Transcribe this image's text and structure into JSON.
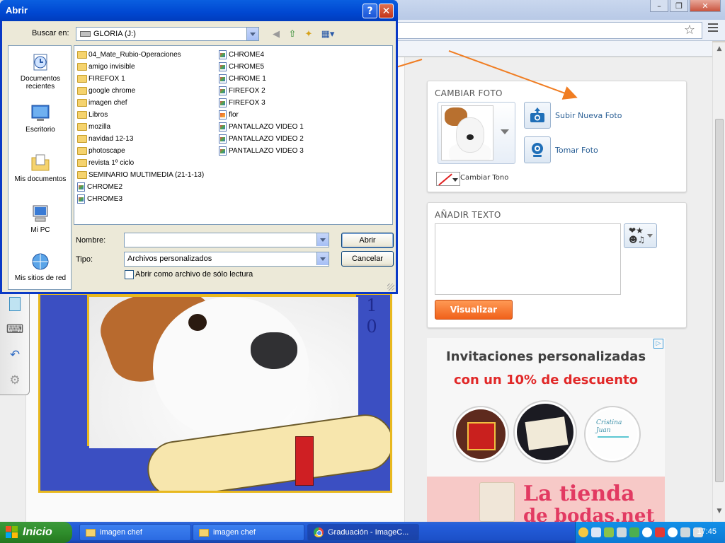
{
  "browser": {
    "window_controls": [
      "minimize",
      "restore",
      "close"
    ],
    "omnibox_value": ""
  },
  "editor": {
    "cambiar_foto": {
      "title": "CAMBIAR FOTO",
      "upload_label": "Subir Nueva Foto",
      "camera_label": "Tomar Foto",
      "tone_label": "Cambiar Tono"
    },
    "anadir_texto": {
      "title": "AÑADIR TEXTO",
      "text_value": "",
      "symbols_label": "❤★\n☻♫",
      "preview_button": "Visualizar"
    },
    "certificate_digits": [
      "1",
      "0"
    ]
  },
  "ad": {
    "headline": "Invitaciones personalizadas",
    "offer": "con un 10% de descuento",
    "brand": "La tienda",
    "brand_sub": "de bodas.net",
    "card_text": "Cristina\nJuan",
    "colors": {
      "offer": "#e12828",
      "brand": "#e23a62",
      "banner": "#f7c9c7"
    }
  },
  "dialog": {
    "title": "Abrir",
    "help_label": "?",
    "close_label": "✕",
    "look_in_label": "Buscar en:",
    "look_in_value": "GLORIA (J:)",
    "places": [
      {
        "label": "Documentos\nrecientes",
        "icon": "recent-documents-icon"
      },
      {
        "label": "Escritorio",
        "icon": "desktop-icon"
      },
      {
        "label": "Mis documentos",
        "icon": "my-documents-icon"
      },
      {
        "label": "Mi PC",
        "icon": "my-computer-icon"
      },
      {
        "label": "Mis sitios de red",
        "icon": "network-places-icon"
      }
    ],
    "files_col1": [
      {
        "name": "04_Mate_Rubio-Operaciones",
        "type": "folder"
      },
      {
        "name": "amigo invisible",
        "type": "folder"
      },
      {
        "name": "FIREFOX 1",
        "type": "folder"
      },
      {
        "name": "google chrome",
        "type": "folder"
      },
      {
        "name": "imagen chef",
        "type": "folder"
      },
      {
        "name": "Libros",
        "type": "folder"
      },
      {
        "name": "mozilla",
        "type": "folder"
      },
      {
        "name": "navidad 12-13",
        "type": "folder"
      },
      {
        "name": "photoscape",
        "type": "folder"
      },
      {
        "name": "revista 1º ciclo",
        "type": "folder"
      },
      {
        "name": "SEMINARIO MULTIMEDIA (21-1-13)",
        "type": "folder"
      },
      {
        "name": "CHROME2",
        "type": "image"
      },
      {
        "name": "CHROME3",
        "type": "image"
      }
    ],
    "files_col2": [
      {
        "name": "CHROME4",
        "type": "image"
      },
      {
        "name": "CHROME5",
        "type": "image"
      },
      {
        "name": "CHROME 1",
        "type": "image"
      },
      {
        "name": "FIREFOX 2",
        "type": "image"
      },
      {
        "name": "FIREFOX 3",
        "type": "image"
      },
      {
        "name": "flor",
        "type": "image"
      },
      {
        "name": "PANTALLAZO VIDEO 1",
        "type": "image"
      },
      {
        "name": "PANTALLAZO VIDEO 2",
        "type": "image"
      },
      {
        "name": "PANTALLAZO VIDEO 3",
        "type": "image"
      }
    ],
    "name_label": "Nombre:",
    "name_value": "",
    "type_label": "Tipo:",
    "type_value": "Archivos personalizados",
    "readonly_label": "Abrir como archivo de sólo lectura",
    "open_button": "Abrir",
    "cancel_button": "Cancelar"
  },
  "palette": {
    "tools": [
      "select-arrow-icon",
      "pen-icon",
      "highlighter-pen-icon",
      "marker-icon",
      "eraser-icon",
      "pie-icon",
      "clipboard-icon",
      "keyboard-icon",
      "undo-icon",
      "settings-icon"
    ]
  },
  "taskbar": {
    "start_label": "Inicio",
    "tasks": [
      {
        "label": "imagen chef",
        "icon": "folder-icon"
      },
      {
        "label": "imagen chef",
        "icon": "folder-icon"
      },
      {
        "label": "Graduación - ImageC...",
        "icon": "chrome-icon"
      }
    ],
    "clock": "17:45"
  }
}
